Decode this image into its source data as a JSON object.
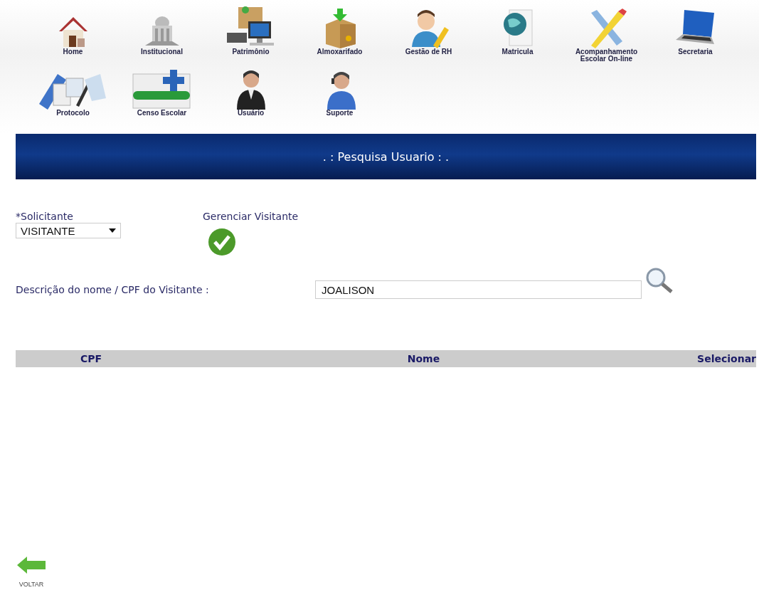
{
  "menu": [
    {
      "label": "Home",
      "kind": "house"
    },
    {
      "label": "Institucional",
      "kind": "building"
    },
    {
      "label": "Patrimônio",
      "kind": "computer"
    },
    {
      "label": "Almoxarifado",
      "kind": "box"
    },
    {
      "label": "Gestão de RH",
      "kind": "person-pencil"
    },
    {
      "label": "Matricula",
      "kind": "globe"
    },
    {
      "label": "Acompanhamento Escolar On-line",
      "kind": "ruler-pencil"
    },
    {
      "label": "Secretaria",
      "kind": "laptop"
    },
    {
      "label": "Protocolo",
      "kind": "documents"
    },
    {
      "label": "Censo Escolar",
      "kind": "census"
    },
    {
      "label": "Usuário",
      "kind": "user"
    },
    {
      "label": "Suporte",
      "kind": "headset"
    }
  ],
  "banner": {
    "title": ". : Pesquisa Usuario : ."
  },
  "form": {
    "requester_label": "*Solicitante",
    "requester_value": "VISITANTE",
    "manage_label": "Gerenciar Visitante",
    "search_label": "Descrição do nome / CPF do Visitante :",
    "search_value": "JOALISON"
  },
  "table": {
    "columns": [
      "CPF",
      "Nome",
      "Selecionar"
    ]
  },
  "back": {
    "label": "VOLTAR"
  }
}
